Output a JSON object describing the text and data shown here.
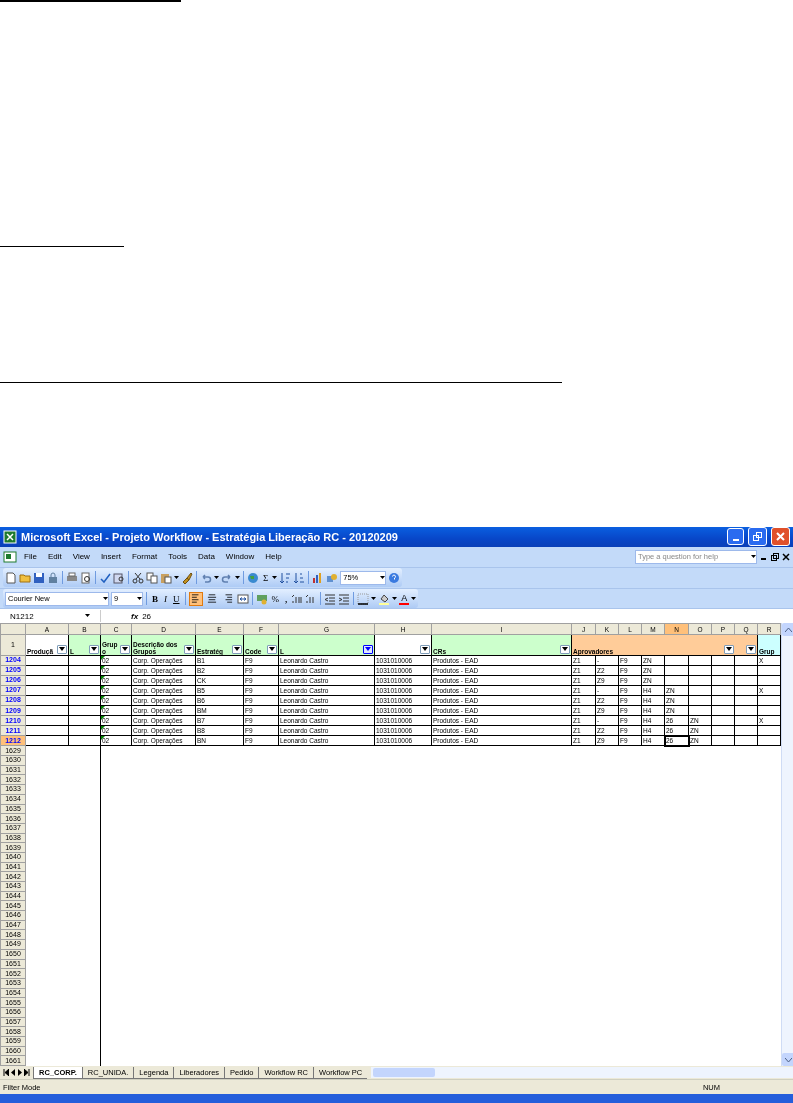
{
  "window": {
    "title": "Microsoft Excel - Projeto Workflow - Estratégia Liberação RC - 20120209"
  },
  "menu": [
    "File",
    "Edit",
    "View",
    "Insert",
    "Format",
    "Tools",
    "Data",
    "Window",
    "Help"
  ],
  "help_search": {
    "placeholder": "Type a question for help"
  },
  "toolbar": {
    "sum": "Σ",
    "zoom": "75%"
  },
  "formatting": {
    "font": "Courier New",
    "size": "9",
    "bold": "B",
    "italic": "I",
    "underline": "U",
    "percent": "%",
    "comma": ",",
    "font_color": "A",
    "alignment": [
      {
        "selected": true
      },
      {
        "selected": false
      },
      {
        "selected": false
      }
    ]
  },
  "formula_bar": {
    "name_box": "N1212",
    "fx": "fx",
    "value": "26"
  },
  "columns": [
    {
      "label": "A",
      "selected": false
    },
    {
      "label": "B",
      "selected": false
    },
    {
      "label": "C",
      "selected": false
    },
    {
      "label": "D",
      "selected": false
    },
    {
      "label": "E",
      "selected": false
    },
    {
      "label": "F",
      "selected": false
    },
    {
      "label": "G",
      "selected": false
    },
    {
      "label": "H",
      "selected": false
    },
    {
      "label": "I",
      "selected": false
    },
    {
      "label": "J",
      "selected": false
    },
    {
      "label": "K",
      "selected": false
    },
    {
      "label": "L",
      "selected": false
    },
    {
      "label": "M",
      "selected": false
    },
    {
      "label": "N",
      "selected": true
    },
    {
      "label": "O",
      "selected": false
    },
    {
      "label": "P",
      "selected": false
    },
    {
      "label": "Q",
      "selected": false
    },
    {
      "label": "R",
      "selected": false
    }
  ],
  "header_row": {
    "number": "1",
    "cells": [
      {
        "text": "Produçã",
        "color": "#ffffff",
        "filter": true,
        "filter_active": false
      },
      {
        "text": "L",
        "color": "#ccffcc",
        "filter": true,
        "filter_active": false
      },
      {
        "text": "Grup o",
        "color": "#ccffcc",
        "filter": true,
        "filter_active": false
      },
      {
        "text": "Descrição dos Grupos",
        "color": "#ccffcc",
        "filter": true,
        "filter_active": false
      },
      {
        "text": "Estratég",
        "color": "#ccffcc",
        "filter": true,
        "filter_active": false
      },
      {
        "text": "Code",
        "color": "#ccffcc",
        "filter": true,
        "filter_active": false
      },
      {
        "text": "L",
        "color": "#ccffcc",
        "filter": true,
        "filter_active": true
      },
      {
        "color": "#ffffff",
        "filter": true,
        "filter_active": false
      },
      {
        "text": "CRs",
        "color": "#ccffcc",
        "filter": true,
        "filter_active": false
      },
      {
        "text": "Aprovadores",
        "color": "#ffcc99"
      },
      {
        "color": "#ffcc99"
      },
      {
        "color": "#ffcc99"
      },
      {
        "color": "#ffcc99"
      },
      {
        "color": "#ffcc99"
      },
      {
        "color": "#ffcc99"
      },
      {
        "color": "#ffcc99",
        "filter": true,
        "filter_active": false
      },
      {
        "color": "#ffcc99",
        "filter": true,
        "filter_active": false
      },
      {
        "text": "Grup",
        "color": "#ccffff"
      }
    ]
  },
  "rows": [
    {
      "number": "1204",
      "selected": false,
      "error_flag": true,
      "cells": [
        null,
        null,
        "02",
        "Corp. Operações",
        "B1",
        "F9",
        "Leonardo Castro",
        "1031010006",
        "Produtos - EAD",
        "Z1",
        "-",
        "F9",
        "ZN",
        null,
        null,
        null,
        null,
        "X"
      ]
    },
    {
      "number": "1205",
      "selected": false,
      "error_flag": true,
      "cells": [
        null,
        null,
        "02",
        "Corp. Operações",
        "B2",
        "F9",
        "Leonardo Castro",
        "1031010006",
        "Produtos - EAD",
        "Z1",
        "Z2",
        "F9",
        "ZN",
        null,
        null,
        null,
        null,
        null
      ]
    },
    {
      "number": "1206",
      "selected": false,
      "error_flag": true,
      "cells": [
        null,
        null,
        "02",
        "Corp. Operações",
        "CK",
        "F9",
        "Leonardo Castro",
        "1031010006",
        "Produtos - EAD",
        "Z1",
        "Z9",
        "F9",
        "ZN",
        null,
        null,
        null,
        null,
        null
      ]
    },
    {
      "number": "1207",
      "selected": false,
      "error_flag": true,
      "cells": [
        null,
        null,
        "02",
        "Corp. Operações",
        "B5",
        "F9",
        "Leonardo Castro",
        "1031010006",
        "Produtos - EAD",
        "Z1",
        "-",
        "F9",
        "H4",
        "ZN",
        null,
        null,
        null,
        "X"
      ]
    },
    {
      "number": "1208",
      "selected": false,
      "error_flag": true,
      "cells": [
        null,
        null,
        "02",
        "Corp. Operações",
        "B6",
        "F9",
        "Leonardo Castro",
        "1031010006",
        "Produtos - EAD",
        "Z1",
        "Z2",
        "F9",
        "H4",
        "ZN",
        null,
        null,
        null,
        null
      ]
    },
    {
      "number": "1209",
      "selected": false,
      "error_flag": true,
      "cells": [
        null,
        null,
        "02",
        "Corp. Operações",
        "BM",
        "F9",
        "Leonardo Castro",
        "1031010006",
        "Produtos - EAD",
        "Z1",
        "Z9",
        "F9",
        "H4",
        "ZN",
        null,
        null,
        null,
        null
      ]
    },
    {
      "number": "1210",
      "selected": false,
      "error_flag": true,
      "cells": [
        null,
        null,
        "02",
        "Corp. Operações",
        "B7",
        "F9",
        "Leonardo Castro",
        "1031010006",
        "Produtos - EAD",
        "Z1",
        "-",
        "F9",
        "H4",
        "26",
        "ZN",
        null,
        null,
        "X"
      ]
    },
    {
      "number": "1211",
      "selected": false,
      "error_flag": true,
      "cells": [
        null,
        null,
        "02",
        "Corp. Operações",
        "B8",
        "F9",
        "Leonardo Castro",
        "1031010006",
        "Produtos - EAD",
        "Z1",
        "Z2",
        "F9",
        "H4",
        "26",
        "ZN",
        null,
        null,
        null
      ]
    },
    {
      "number": "1212",
      "selected": true,
      "error_flag": true,
      "cells": [
        null,
        null,
        "02",
        "Corp. Operações",
        "BN",
        "F9",
        "Leonardo Castro",
        "1031010006",
        "Produtos - EAD",
        "Z1",
        "Z9",
        "F9",
        "H4",
        "26",
        "ZN",
        null,
        null,
        null
      ]
    }
  ],
  "empty_rows": [
    "1629",
    "1630",
    "1631",
    "1632",
    "1633",
    "1634",
    "1635",
    "1636",
    "1637",
    "1638",
    "1639",
    "1640",
    "1641",
    "1642",
    "1643",
    "1644",
    "1645",
    "1646",
    "1647",
    "1648",
    "1649",
    "1650",
    "1651",
    "1652",
    "1653",
    "1654",
    "1655",
    "1656",
    "1657",
    "1658",
    "1659",
    "1660",
    "1661"
  ],
  "sheet_tabs": [
    {
      "label": "RC_CORP.",
      "selected": true
    },
    {
      "label": "RC_UNIDA.",
      "selected": false
    },
    {
      "label": "Legenda",
      "selected": false
    },
    {
      "label": "Liberadores",
      "selected": false
    },
    {
      "label": "Pedido",
      "selected": false
    },
    {
      "label": "Workflow RC",
      "selected": false
    },
    {
      "label": "Workflow PC",
      "selected": false
    }
  ],
  "status_bar": {
    "mode": "Filter Mode",
    "num": "NUM"
  }
}
